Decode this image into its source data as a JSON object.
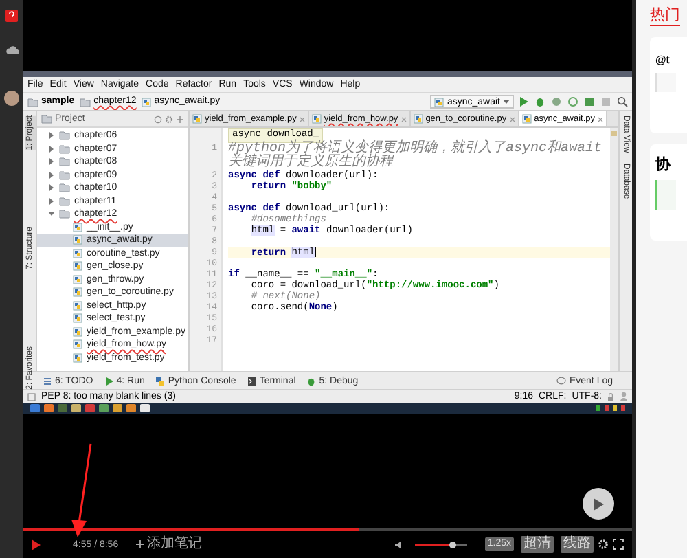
{
  "ide": {
    "menu": [
      "File",
      "Edit",
      "View",
      "Navigate",
      "Code",
      "Refactor",
      "Run",
      "Tools",
      "VCS",
      "Window",
      "Help"
    ],
    "breadcrumbs": [
      {
        "label": "sample",
        "problem": false
      },
      {
        "label": "chapter12",
        "problem": true
      },
      {
        "label": "async_await.py",
        "problem": false
      }
    ],
    "run_config": "async_await",
    "left_tools": [
      {
        "label": "1: Project",
        "selected": true
      },
      {
        "label": "7: Structure",
        "selected": false
      },
      {
        "label": "2: Favorites",
        "selected": false
      }
    ],
    "right_tools": [
      "Data View",
      "Database"
    ],
    "project": {
      "title": "Project",
      "tree": [
        {
          "name": "chapter06",
          "expanded": false,
          "selected": false,
          "problem": false
        },
        {
          "name": "chapter07",
          "expanded": false,
          "selected": false,
          "problem": false
        },
        {
          "name": "chapter08",
          "expanded": false,
          "selected": false,
          "problem": false
        },
        {
          "name": "chapter09",
          "expanded": false,
          "selected": false,
          "problem": false
        },
        {
          "name": "chapter10",
          "expanded": false,
          "selected": false,
          "problem": false
        },
        {
          "name": "chapter11",
          "expanded": false,
          "selected": false,
          "problem": false
        },
        {
          "name": "chapter12",
          "expanded": true,
          "selected": false,
          "problem": true,
          "children": [
            {
              "name": "__init__.py",
              "selected": false,
              "problem": false
            },
            {
              "name": "async_await.py",
              "selected": true,
              "problem": false
            },
            {
              "name": "coroutine_test.py",
              "selected": false,
              "problem": false
            },
            {
              "name": "gen_close.py",
              "selected": false,
              "problem": false
            },
            {
              "name": "gen_throw.py",
              "selected": false,
              "problem": false
            },
            {
              "name": "gen_to_coroutine.py",
              "selected": false,
              "problem": false
            },
            {
              "name": "select_http.py",
              "selected": false,
              "problem": false
            },
            {
              "name": "select_test.py",
              "selected": false,
              "problem": false
            },
            {
              "name": "yield_from_example.py",
              "selected": false,
              "problem": false
            },
            {
              "name": "yield_from_how.py",
              "selected": false,
              "problem": true
            },
            {
              "name": "yield_from_test.py",
              "selected": false,
              "problem": false
            }
          ]
        }
      ]
    },
    "tabs": [
      {
        "label": "yield_from_example.py",
        "selected": false,
        "problem": false
      },
      {
        "label": "yield_from_how.py",
        "selected": false,
        "problem": true
      },
      {
        "label": "gen_to_coroutine.py",
        "selected": false,
        "problem": false
      },
      {
        "label": "async_await.py",
        "selected": true,
        "problem": false
      }
    ],
    "context_hint": "async download_",
    "code": [
      {
        "number": "1",
        "current": false,
        "tokens": [
          {
            "kind": "comment",
            "text": "#python为了将语义变得更加明确，就引入了async和await关键词用于定义原生的协程"
          }
        ]
      },
      {
        "number": "2",
        "current": false,
        "tokens": [
          {
            "kind": "keyword",
            "text": "async def "
          },
          {
            "kind": "plain",
            "text": "downloader(url):"
          }
        ]
      },
      {
        "number": "3",
        "current": false,
        "tokens": [
          {
            "kind": "keyword",
            "text": "    return "
          },
          {
            "kind": "string",
            "text": "\"bobby\""
          }
        ]
      },
      {
        "number": "4",
        "current": false
      },
      {
        "number": "5",
        "current": false,
        "tokens": [
          {
            "kind": "keyword",
            "text": "async def "
          },
          {
            "kind": "plain",
            "text": "download_url(url):"
          }
        ]
      },
      {
        "number": "6",
        "current": false,
        "tokens": [
          {
            "kind": "comment",
            "text": "    #dosomethings"
          }
        ]
      },
      {
        "number": "7",
        "current": false,
        "tokens": [
          {
            "kind": "ref",
            "text": "    html"
          },
          {
            "kind": "plain",
            "text": " = "
          },
          {
            "kind": "keyword",
            "text": "await "
          },
          {
            "kind": "plain",
            "text": "downloader(url)"
          }
        ]
      },
      {
        "number": "8",
        "current": false
      },
      {
        "number": "9",
        "current": true,
        "tokens": [
          {
            "kind": "keyword",
            "text": "    return "
          },
          {
            "kind": "ref",
            "text": "html"
          }
        ]
      },
      {
        "number": "10",
        "current": false
      },
      {
        "number": "11",
        "current": false,
        "tokens": [
          {
            "kind": "keyword",
            "text": "if "
          },
          {
            "kind": "plain",
            "text": "__name__ == "
          },
          {
            "kind": "string",
            "text": "\"__main__\""
          },
          {
            "kind": "plain",
            "text": ":"
          }
        ]
      },
      {
        "number": "12",
        "current": false,
        "tokens": [
          {
            "kind": "plain",
            "text": "    coro = download_url("
          },
          {
            "kind": "string",
            "text": "\"http://www.imooc.com\""
          },
          {
            "kind": "plain",
            "text": ")"
          }
        ]
      },
      {
        "number": "13",
        "current": false,
        "tokens": [
          {
            "kind": "comment",
            "text": "    # next(None)"
          }
        ]
      },
      {
        "number": "14",
        "current": false,
        "tokens": [
          {
            "kind": "plain",
            "text": "    coro.send("
          },
          {
            "kind": "keyword",
            "text": "None"
          },
          {
            "kind": "plain",
            "text": ")"
          }
        ]
      },
      {
        "number": "15",
        "current": false
      },
      {
        "number": "16",
        "current": false
      },
      {
        "number": "17",
        "current": false
      }
    ],
    "tool_windows": [
      "6: TODO",
      "4: Run",
      "Python Console",
      "Terminal",
      "5: Debug"
    ],
    "event_log": "Event Log",
    "status": {
      "message": "PEP 8: too many blank lines (3)",
      "position": "9:16",
      "line_separator": "CRLF:",
      "encoding": "UTF-8:"
    }
  },
  "player": {
    "progress": {
      "level": 0.55
    },
    "time": "4:55 / 8:56",
    "add_note": "添加笔记",
    "volume": {
      "level": 0.74
    },
    "speed": "1.25x",
    "quality": "超清",
    "route": "线路"
  },
  "right_panel": {
    "tab": "热门",
    "card_title": "@t",
    "section_title": "协"
  }
}
